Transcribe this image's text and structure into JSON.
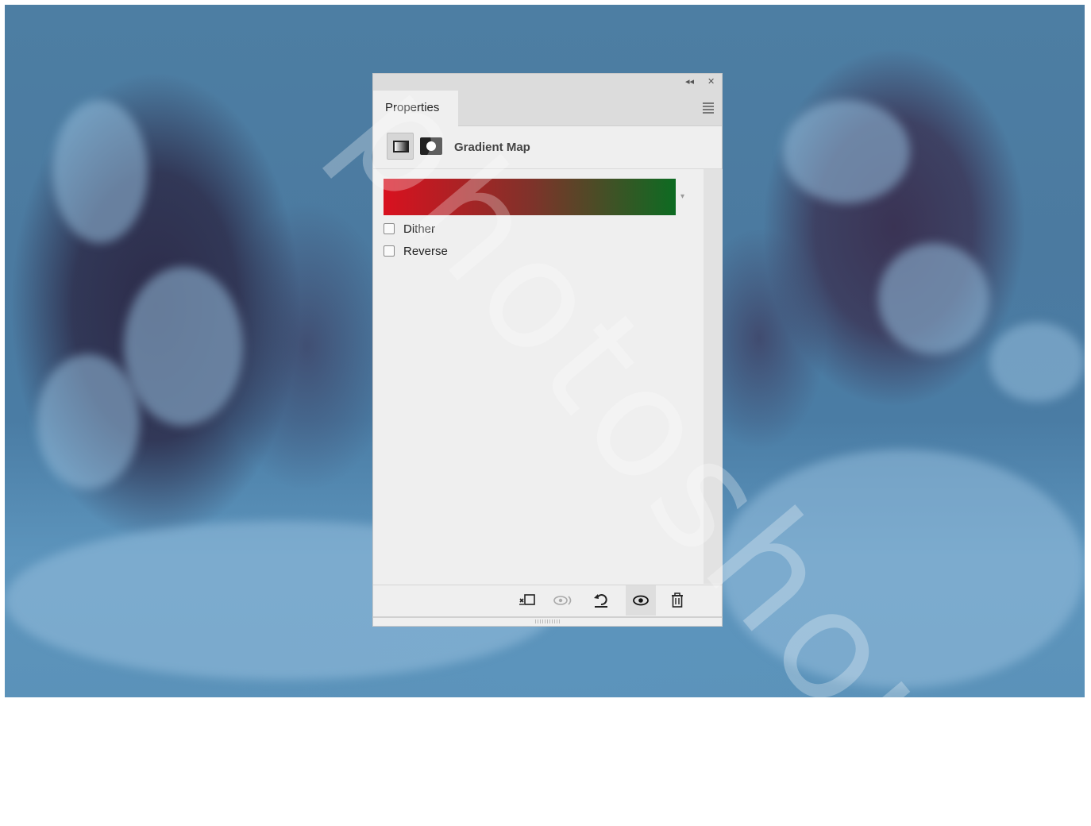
{
  "panel": {
    "tab_label": "Properties",
    "adjustment_title": "Gradient Map",
    "gradient": {
      "start_color": "#d9111f",
      "mid_color": "#80322a",
      "end_color": "#0d6b22"
    },
    "options": [
      {
        "label": "Dither",
        "checked": false
      },
      {
        "label": "Reverse",
        "checked": false
      }
    ],
    "topbar": {
      "collapse_glyph": "◂◂",
      "close_glyph": "✕"
    },
    "footer_buttons": [
      "clip-to-layer-icon",
      "view-previous-state-icon",
      "reset-icon",
      "toggle-visibility-icon",
      "delete-icon"
    ]
  },
  "watermark": {
    "text": "photoshop"
  }
}
